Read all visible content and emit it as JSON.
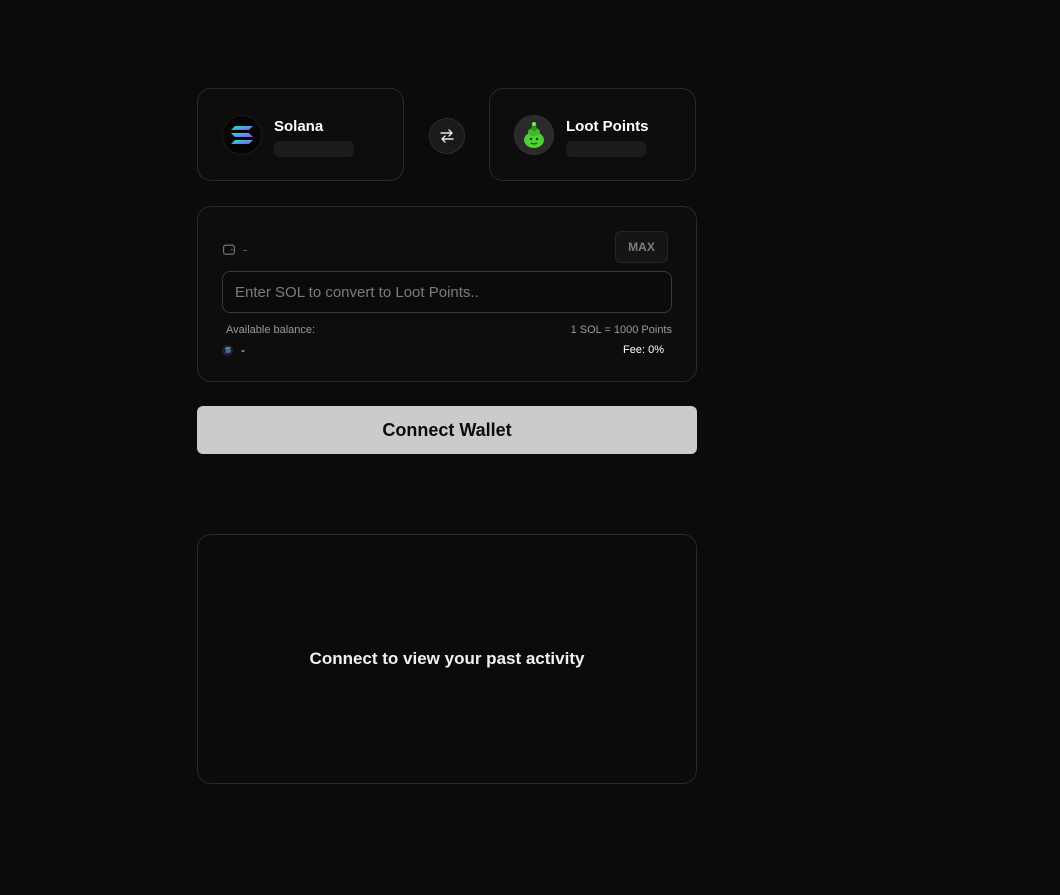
{
  "from_token": {
    "name": "Solana",
    "icon": "solana-icon"
  },
  "to_token": {
    "name": "Loot Points",
    "icon": "loot-points-icon"
  },
  "swap_icon": "swap-arrows-icon",
  "panel": {
    "wallet_icon": "wallet-icon",
    "wallet_value": "-",
    "max_label": "MAX",
    "input_placeholder": "Enter SOL to convert to Loot Points..",
    "available_label": "Available balance:",
    "available_value": "-",
    "rate_label": "1 SOL = 1000 Points",
    "fee_label": "Fee: 0%"
  },
  "connect_button": "Connect Wallet",
  "activity": {
    "message": "Connect to view your past activity"
  },
  "colors": {
    "background": "#0b0b0b",
    "card_border": "#2a2a2a",
    "button": "#cbcbcb",
    "loot_green": "#4cd137"
  }
}
